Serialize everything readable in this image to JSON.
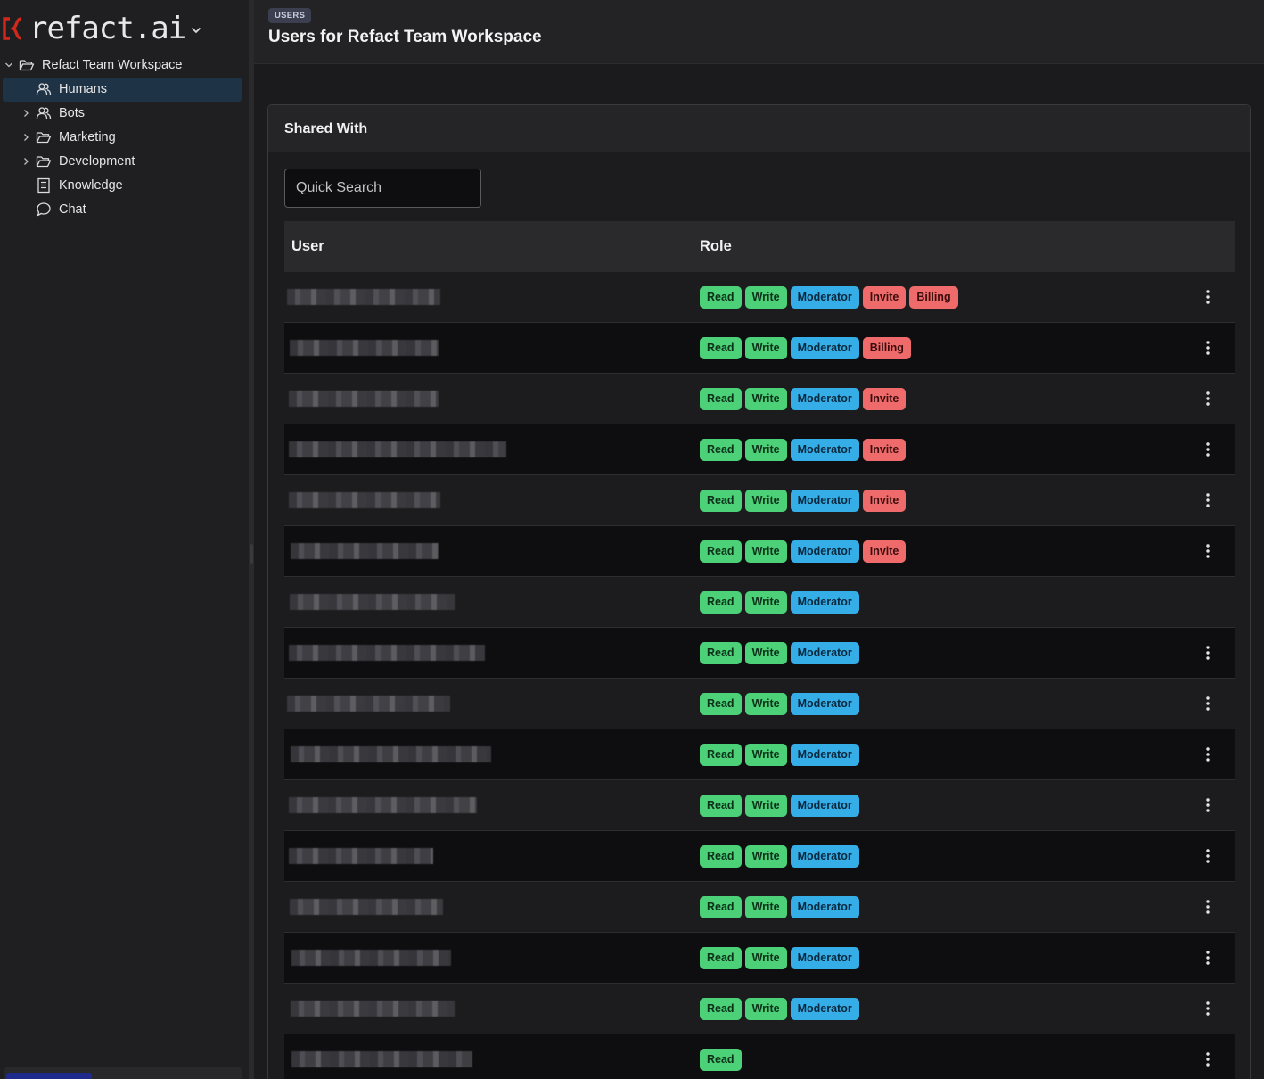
{
  "app": {
    "logo_text": "refact.ai"
  },
  "sidebar": {
    "items": [
      {
        "label": "Refact Team Workspace",
        "icon": "folder-open-icon",
        "chevron": "down",
        "level": 0
      },
      {
        "label": "Humans",
        "icon": "users-icon",
        "chevron": "none",
        "level": 1,
        "selected": true
      },
      {
        "label": "Bots",
        "icon": "users-icon",
        "chevron": "right",
        "level": 1
      },
      {
        "label": "Marketing",
        "icon": "folder-open-icon",
        "chevron": "right",
        "level": 1
      },
      {
        "label": "Development",
        "icon": "folder-open-icon",
        "chevron": "right",
        "level": 1
      },
      {
        "label": "Knowledge",
        "icon": "document-icon",
        "chevron": "none",
        "level": 1
      },
      {
        "label": "Chat",
        "icon": "chat-bubble-icon",
        "chevron": "none",
        "level": 1
      }
    ]
  },
  "header": {
    "badge": "USERS",
    "title": "Users for Refact Team Workspace"
  },
  "card": {
    "title": "Shared With",
    "search_placeholder": "Quick Search",
    "columns": {
      "user": "User",
      "role": "Role"
    },
    "rows": [
      {
        "roles": [
          "Read",
          "Write",
          "Moderator",
          "Invite",
          "Billing"
        ],
        "menu": true
      },
      {
        "roles": [
          "Read",
          "Write",
          "Moderator",
          "Billing"
        ],
        "menu": true
      },
      {
        "roles": [
          "Read",
          "Write",
          "Moderator",
          "Invite"
        ],
        "menu": true
      },
      {
        "roles": [
          "Read",
          "Write",
          "Moderator",
          "Invite"
        ],
        "menu": true
      },
      {
        "roles": [
          "Read",
          "Write",
          "Moderator",
          "Invite"
        ],
        "menu": true
      },
      {
        "roles": [
          "Read",
          "Write",
          "Moderator",
          "Invite"
        ],
        "menu": true
      },
      {
        "roles": [
          "Read",
          "Write",
          "Moderator"
        ],
        "menu": false
      },
      {
        "roles": [
          "Read",
          "Write",
          "Moderator"
        ],
        "menu": true
      },
      {
        "roles": [
          "Read",
          "Write",
          "Moderator"
        ],
        "menu": true
      },
      {
        "roles": [
          "Read",
          "Write",
          "Moderator"
        ],
        "menu": true
      },
      {
        "roles": [
          "Read",
          "Write",
          "Moderator"
        ],
        "menu": true
      },
      {
        "roles": [
          "Read",
          "Write",
          "Moderator"
        ],
        "menu": true
      },
      {
        "roles": [
          "Read",
          "Write",
          "Moderator"
        ],
        "menu": true
      },
      {
        "roles": [
          "Read",
          "Write",
          "Moderator"
        ],
        "menu": true
      },
      {
        "roles": [
          "Read",
          "Write",
          "Moderator"
        ],
        "menu": true
      },
      {
        "roles": [
          "Read"
        ],
        "menu": true
      }
    ]
  },
  "colors": {
    "role_read": "#4cd078",
    "role_write": "#4cd078",
    "role_moderator": "#35aee8",
    "role_invite": "#ef6b6b",
    "role_billing": "#ef6b6b",
    "logo_accent": "#d0281c",
    "selected_item": "#1f3346"
  }
}
